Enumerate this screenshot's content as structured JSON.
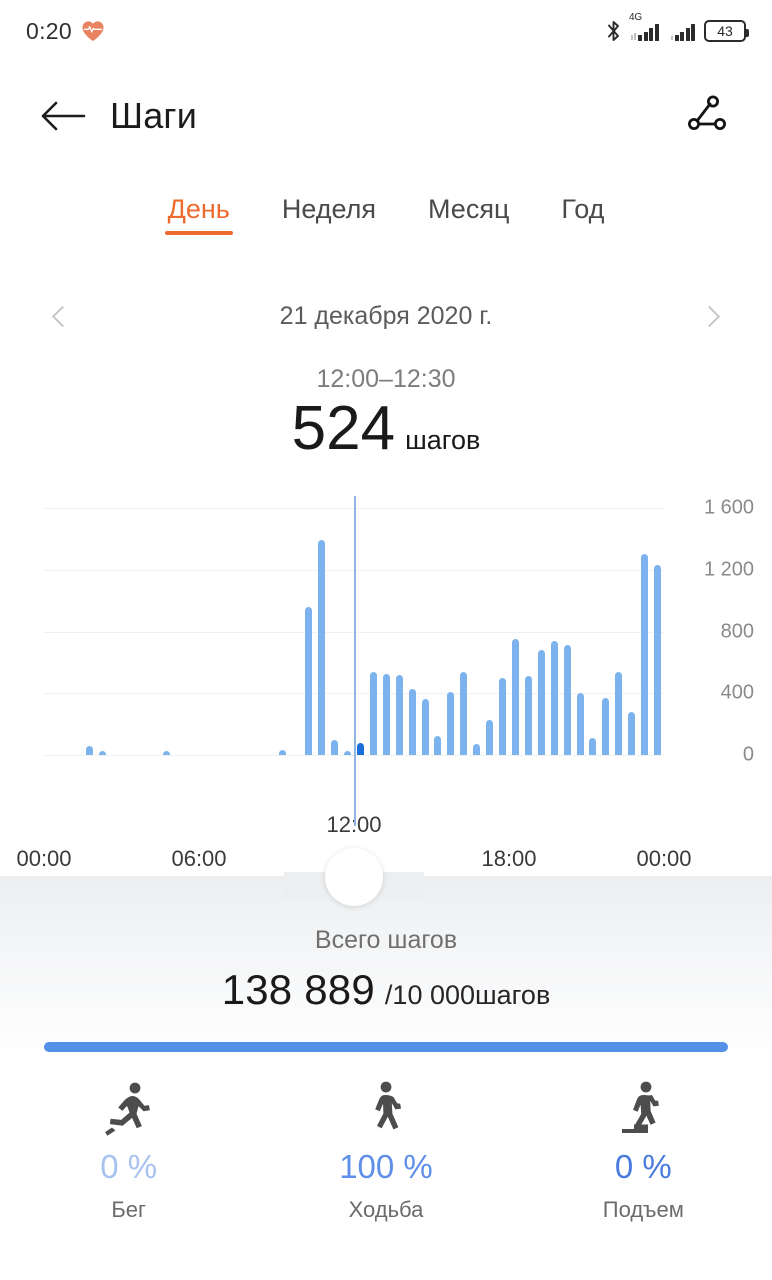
{
  "status_bar": {
    "clock": "0:20",
    "heart_icon": "heart-rate-icon",
    "bluetooth_icon": "bluetooth-icon",
    "network_type": "4G",
    "battery_level": "43"
  },
  "app_bar": {
    "back_icon": "back-arrow-icon",
    "title": "Шаги",
    "share_icon": "share-icon"
  },
  "tabs": [
    {
      "label": "День",
      "active": true
    },
    {
      "label": "Неделя",
      "active": false
    },
    {
      "label": "Месяц",
      "active": false
    },
    {
      "label": "Год",
      "active": false
    }
  ],
  "date_nav": {
    "prev_icon": "chevron-left-icon",
    "next_icon": "chevron-right-icon",
    "date": "21 декабря 2020 г."
  },
  "selection": {
    "range": "12:00–12:30",
    "value": "524",
    "unit": "шагов"
  },
  "totals": {
    "label": "Всего шагов",
    "value": "138 889",
    "goal": "/10 000шагов",
    "progress_percent": 100
  },
  "stats": [
    {
      "icon": "running-icon",
      "percent": "0 %",
      "label": "Бег",
      "color": "#a8c3f0"
    },
    {
      "icon": "walking-icon",
      "percent": "100 %",
      "label": "Ходьба",
      "color": "#5f8fe8"
    },
    {
      "icon": "stair-climb-icon",
      "percent": "0 %",
      "label": "Подъем",
      "color": "#4a7ce0"
    }
  ],
  "colors": {
    "accent_orange": "#ee6b2f",
    "bar_blue": "#7cb3ee",
    "bar_selected_blue": "#1a6fdb",
    "progress_blue": "#5590e8"
  },
  "chart_data": {
    "type": "bar",
    "title": "",
    "xlabel": "",
    "ylabel": "",
    "ylim": [
      0,
      1600
    ],
    "yticks": [
      0,
      400,
      800,
      1200,
      1600
    ],
    "ytick_labels": [
      "0",
      "400",
      "800",
      "1 200",
      "1 600"
    ],
    "grid": true,
    "legend": "none",
    "x_axis_labels": [
      "00:00",
      "06:00",
      "18:00",
      "00:00"
    ],
    "x_axis_label_positions": [
      0,
      6,
      18,
      24
    ],
    "cursor_label": "12:00",
    "cursor_hour": 12,
    "selected_index": 24,
    "selected_value": 524,
    "bin_minutes": 30,
    "categories": [
      "00:00",
      "00:30",
      "01:00",
      "01:30",
      "02:00",
      "02:30",
      "03:00",
      "03:30",
      "04:00",
      "04:30",
      "05:00",
      "05:30",
      "06:00",
      "06:30",
      "07:00",
      "07:30",
      "08:00",
      "08:30",
      "09:00",
      "09:30",
      "10:00",
      "10:30",
      "11:00",
      "11:30",
      "12:00",
      "12:30",
      "13:00",
      "13:30",
      "14:00",
      "14:30",
      "15:00",
      "15:30",
      "16:00",
      "16:30",
      "17:00",
      "17:30",
      "18:00",
      "18:30",
      "19:00",
      "19:30",
      "20:00",
      "20:30",
      "21:00",
      "21:30",
      "22:00",
      "22:30",
      "23:00",
      "23:30"
    ],
    "values": [
      0,
      0,
      0,
      60,
      12,
      0,
      0,
      0,
      0,
      18,
      0,
      0,
      0,
      0,
      0,
      0,
      0,
      0,
      30,
      0,
      960,
      1390,
      95,
      20,
      75,
      540,
      524,
      520,
      430,
      360,
      120,
      405,
      540,
      70,
      230,
      500,
      750,
      510,
      680,
      740,
      710,
      400,
      110,
      370,
      540,
      280,
      1300,
      1230
    ]
  }
}
